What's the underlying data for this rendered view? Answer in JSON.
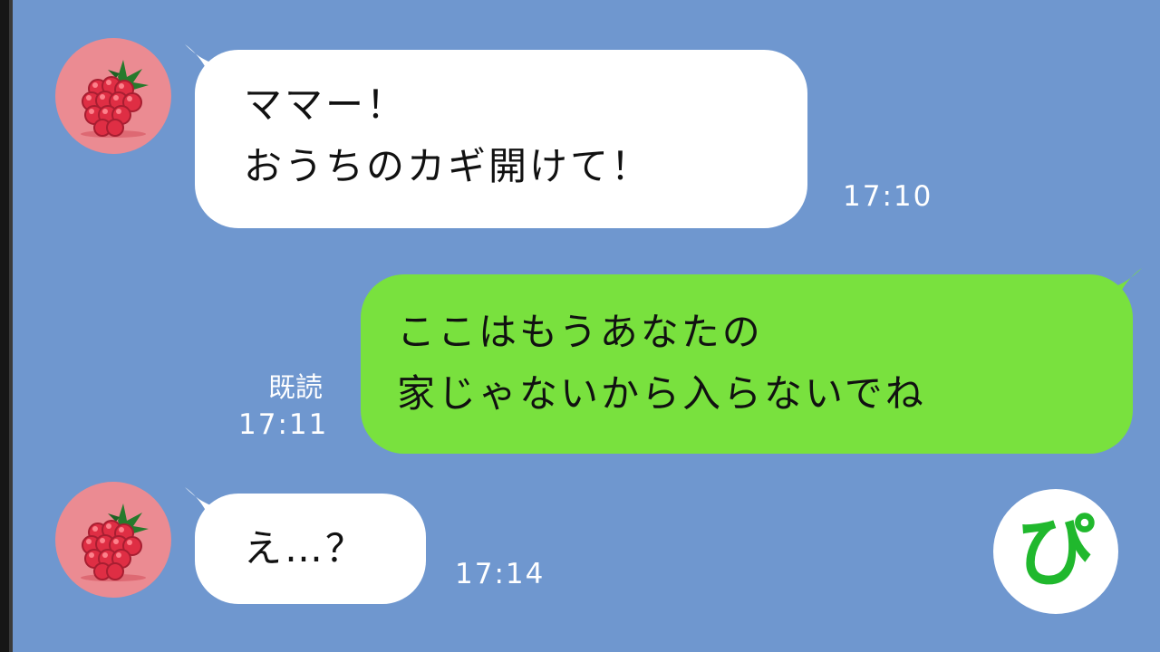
{
  "theme": {
    "background": "#6f97cf",
    "incoming_bubble": "#ffffff",
    "outgoing_bubble": "#79e13e",
    "avatar_background": "#eb8b92",
    "logo_color": "#20b82d"
  },
  "messages": [
    {
      "direction": "incoming",
      "avatar": "raspberry-icon",
      "lines": [
        "ママー！",
        "おうちのカギ開けて！"
      ],
      "time": "17:10"
    },
    {
      "direction": "outgoing",
      "lines": [
        "ここはもうあなたの",
        "家じゃないから入らないでね"
      ],
      "read": "既読",
      "time": "17:11"
    },
    {
      "direction": "incoming",
      "avatar": "raspberry-icon",
      "lines": [
        "え…？"
      ],
      "time": "17:14"
    }
  ],
  "logo": {
    "text": "ぴ",
    "icon": "pi-logo-icon"
  }
}
